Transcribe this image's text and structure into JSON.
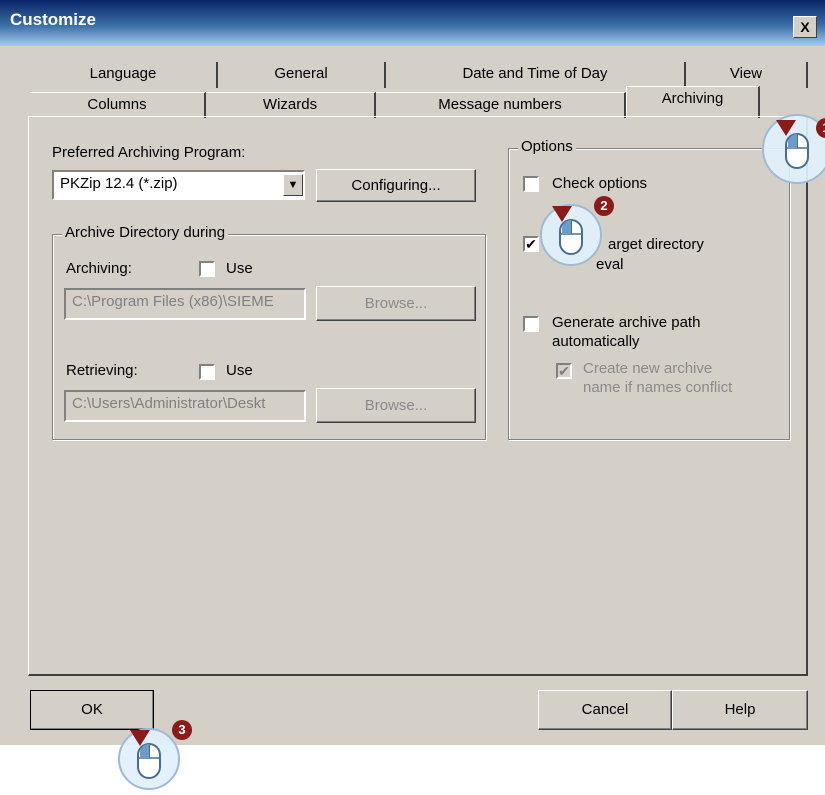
{
  "window": {
    "title": "Customize",
    "close_glyph": "X"
  },
  "tabs": {
    "row1": [
      "Language",
      "General",
      "Date and Time of Day",
      "View"
    ],
    "row2": [
      "Columns",
      "Wizards",
      "Message numbers",
      "Archiving"
    ],
    "active": "Archiving"
  },
  "archiving": {
    "preferred_label": "Preferred Archiving Program:",
    "program_selected": "PKZip 12.4 (*.zip)",
    "configuring_button": "Configuring...",
    "archive_dir_group": "Archive Directory during",
    "archiving_label": "Archiving:",
    "archiving_use": {
      "label": "Use",
      "checked": false
    },
    "archiving_path": "C:\\Program Files (x86)\\SIEME",
    "browse_label": "Browse...",
    "retrieving_label": "Retrieving:",
    "retrieving_use": {
      "label": "Use",
      "checked": false
    },
    "retrieving_path": "C:\\Users\\Administrator\\Deskt"
  },
  "options": {
    "group_label": "Options",
    "check_options": {
      "label": "Check options",
      "checked": false
    },
    "target_dir": {
      "label_line1": "arget directory",
      "label_line2": "eval",
      "checked": true
    },
    "generate_path": {
      "label_line1": "Generate archive path",
      "label_line2": "automatically",
      "checked": false
    },
    "create_name": {
      "label_line1": "Create new archive",
      "label_line2": "name if names conflict",
      "checked": true,
      "disabled": true
    }
  },
  "footer": {
    "ok": "OK",
    "cancel": "Cancel",
    "help": "Help"
  },
  "callouts": {
    "badge1": "1",
    "badge2": "2",
    "badge3": "3"
  },
  "colors": {
    "title_start": "#0a246a",
    "title_end": "#a6caf0",
    "dialog_bg": "#d4d0c8",
    "badge": "#8b1a1a"
  }
}
